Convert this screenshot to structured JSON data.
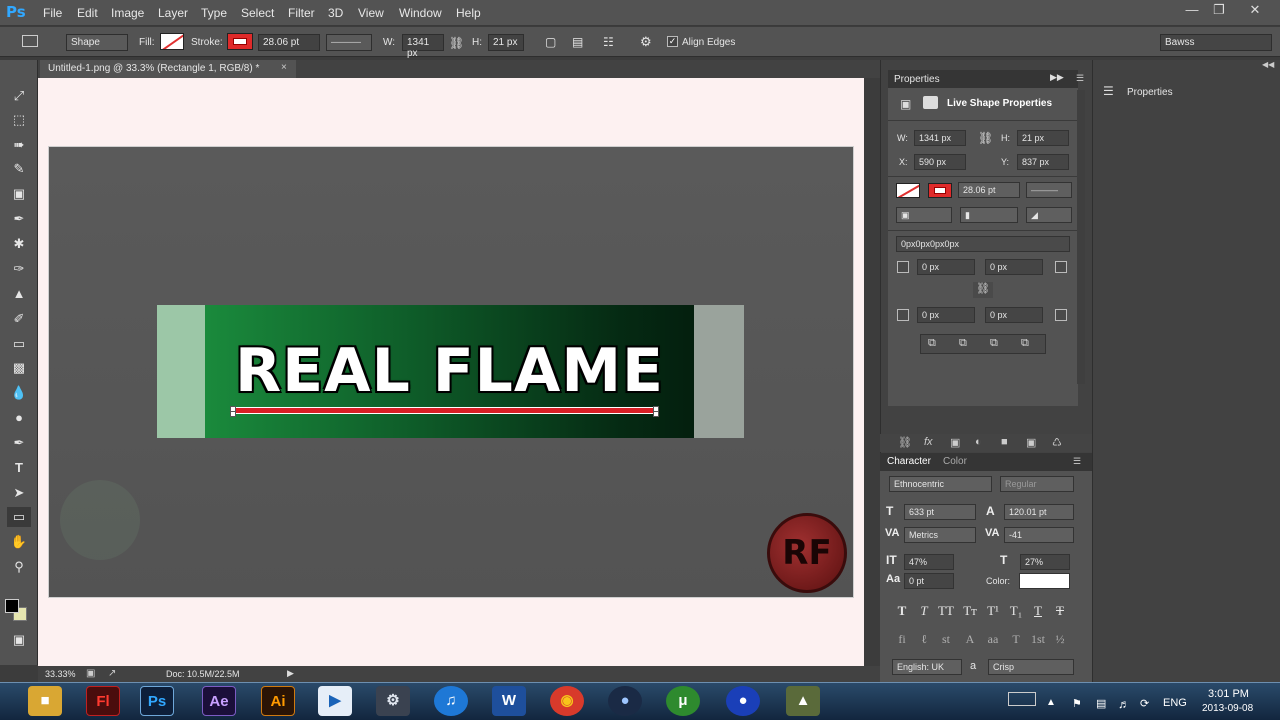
{
  "app": {
    "logo": "Ps"
  },
  "menu": [
    "File",
    "Edit",
    "Image",
    "Layer",
    "Type",
    "Select",
    "Filter",
    "3D",
    "View",
    "Window",
    "Help"
  ],
  "options": {
    "tool_mode": "Shape",
    "fill_label": "Fill:",
    "stroke_label": "Stroke:",
    "stroke_width": "28.06 pt",
    "w_label": "W:",
    "w_value": "1341 px",
    "h_label": "H:",
    "h_value": "21 px",
    "align_edges": "Align Edges",
    "workspace": "Bawss"
  },
  "document": {
    "tab_title": "Untitled-1.png @ 33.3% (Rectangle 1, RGB/8) *",
    "banner_text": "REAL FLAME",
    "logo_text": "RF"
  },
  "status": {
    "zoom": "33.33%",
    "doc": "Doc: 10.5M/22.5M"
  },
  "properties": {
    "tab": "Properties",
    "title": "Live Shape Properties",
    "w_label": "W:",
    "w": "1341 px",
    "h_label": "H:",
    "h": "21 px",
    "x_label": "X:",
    "x": "590 px",
    "y_label": "Y:",
    "y": "837 px",
    "stroke_width": "28.06 pt",
    "radius_summary": "0px0px0px0px",
    "r1": "0 px",
    "r2": "0 px",
    "r3": "0 px",
    "r4": "0 px"
  },
  "right_panel": {
    "title": "Properties"
  },
  "character": {
    "tab1": "Character",
    "tab2": "Color",
    "font": "Ethnocentric",
    "style": "Regular",
    "size": "633 pt",
    "leading": "120.01 pt",
    "kerning": "Metrics",
    "tracking": "-41",
    "vscale": "47%",
    "hscale": "27%",
    "baseline": "0 pt",
    "color_label": "Color:",
    "language": "English: UK",
    "aa_label": "a",
    "antialias": "Crisp"
  },
  "taskbar": {
    "lang": "ENG",
    "time": "3:01 PM",
    "date": "2013-09-08"
  }
}
